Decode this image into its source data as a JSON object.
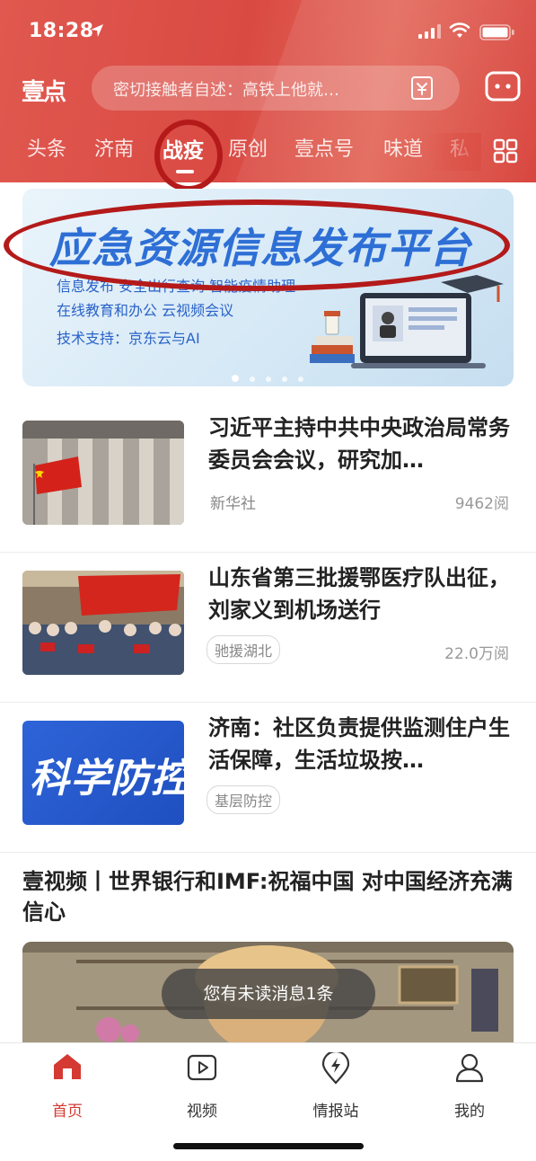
{
  "status_bar": {
    "time": "18:28"
  },
  "header": {
    "logo_text": "壹点",
    "search_placeholder": "密切接触者自述：高铁上他就…",
    "tabs": [
      {
        "label": "头条",
        "active": false
      },
      {
        "label": "济南",
        "active": false
      },
      {
        "label": "战疫",
        "active": true
      },
      {
        "label": "原创",
        "active": false
      },
      {
        "label": "壹点号",
        "active": false
      },
      {
        "label": "味道",
        "active": false
      },
      {
        "label": "私",
        "active": false
      }
    ]
  },
  "banner": {
    "title": "应急资源信息发布平台",
    "line1": "信息发布   安全出行查询   智能疫情助理",
    "line2": "在线教育和办公   云视频会议",
    "line3": "技术支持：京东云与AI",
    "dots_count": 5,
    "active_dot": 0
  },
  "news": [
    {
      "title": "习近平主持中共中央政治局常务委员会会议，研究加…",
      "source": "新华社",
      "tag": "",
      "reads": "9462阅"
    },
    {
      "title": "山东省第三批援鄂医疗队出征，刘家义到机场送行",
      "source": "",
      "tag": "驰援湖北",
      "reads": "22.0万阅"
    },
    {
      "title": "济南：社区负责提供监测住户生活保障，生活垃圾按…",
      "source": "",
      "tag": "基层防控",
      "reads": "",
      "thumb_text": "科学防控"
    }
  ],
  "video": {
    "title": "壹视频丨世界银行和IMF:祝福中国 对中国经济充满信心"
  },
  "toast": "您有未读消息1条",
  "bottom_nav": [
    {
      "label": "首页",
      "icon": "home-icon",
      "active": true
    },
    {
      "label": "视频",
      "icon": "video-icon",
      "active": false
    },
    {
      "label": "情报站",
      "icon": "intel-station-icon",
      "active": false
    },
    {
      "label": "我的",
      "icon": "profile-icon",
      "active": false
    }
  ],
  "colors": {
    "brand_red": "#d94a43",
    "active_nav": "#d43a32",
    "annotation_red": "#b41a1a",
    "banner_blue": "#2e6fd6"
  }
}
